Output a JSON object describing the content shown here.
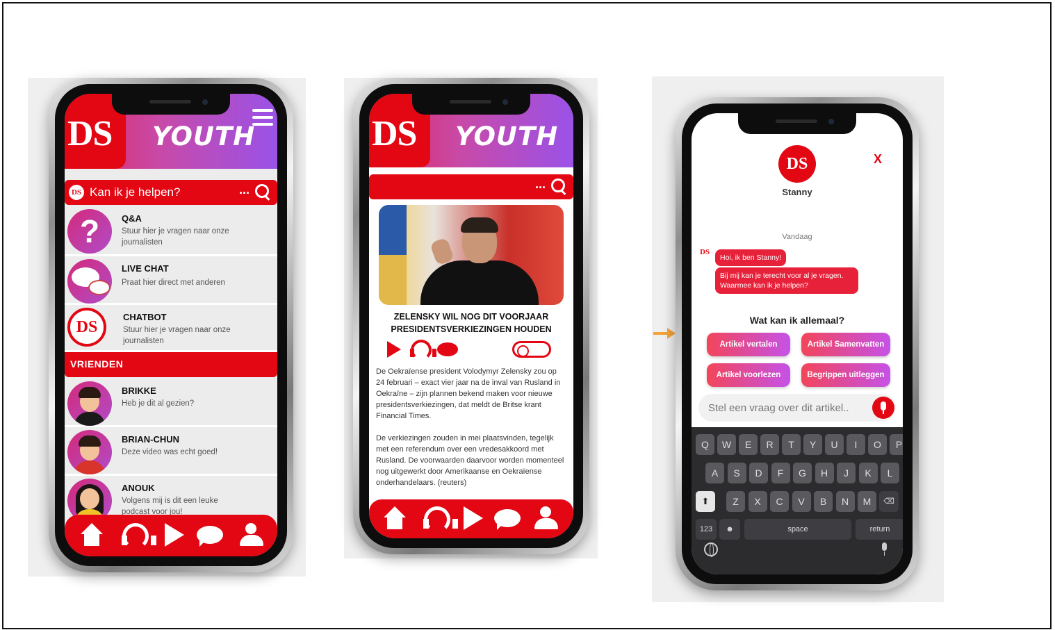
{
  "brand": {
    "ds": "DS",
    "youth": "YOUTH",
    "logo_mini": "DS"
  },
  "phone1": {
    "search": {
      "placeholder": "Kan ik je helpen?",
      "dots": "..."
    },
    "items": [
      {
        "title": "Q&A",
        "subtitle": "Stuur hier je vragen naar onze journalisten",
        "icon": "question-icon",
        "glyph": "?"
      },
      {
        "title": "LIVE CHAT",
        "subtitle": "Praat hier direct met anderen",
        "icon": "chat-bubbles-icon"
      },
      {
        "title": "CHATBOT",
        "subtitle": "Stuur hier je vragen naar onze journalisten",
        "icon": "chatbot-logo-icon",
        "glyph": "DS"
      }
    ],
    "section_label": "VRIENDEN",
    "friends": [
      {
        "name": "BRIKKE",
        "message": "Heb je dit al gezien?"
      },
      {
        "name": "BRIAN-CHUN",
        "message": "Deze video was echt goed!"
      },
      {
        "name": "ANOUK",
        "message": "Volgens mij is dit een leuke podcast voor jou!"
      }
    ]
  },
  "phone2": {
    "search": {
      "dots": "..."
    },
    "headline": "ZELENSKY WIL NOG DIT VOORJAAR PRESIDENTSVERKIEZINGEN HOUDEN",
    "paragraph1": "De Oekraïense president Volodymyr Zelensky zou op 24 februari – exact vier jaar na de inval van Rusland in Oekraïne – zijn plannen bekend maken voor nieuwe presidentsverkiezingen, dat meldt de Britse krant Financial Times.",
    "paragraph2": "De verkiezingen zouden in mei plaatsvinden, tegelijk met een referendum over een vredesakkoord met Rusland. De voorwaarden daarvoor worden momenteel nog uitgewerkt door Amerikaanse en Oekraïense onderhandelaars. (reuters)"
  },
  "phone3": {
    "bot_logo": "DS",
    "bot_name": "Stanny",
    "close": "X",
    "date": "Vandaag",
    "messages": [
      "Hoi, ik ben Stanny!",
      "Bij mij kan je terecht voor al je vragen. Waarmee kan ik je helpen?"
    ],
    "options_title": "Wat kan ik allemaal?",
    "options": [
      "Artikel vertalen",
      "Artikel Samenvatten",
      "Artikel voorlezen",
      "Begrippen uitleggen"
    ],
    "input_placeholder": "Stel een vraag over dit artikel..",
    "keyboard": {
      "row1": [
        "Q",
        "W",
        "E",
        "R",
        "T",
        "Y",
        "U",
        "I",
        "O",
        "P"
      ],
      "row2": [
        "A",
        "S",
        "D",
        "F",
        "G",
        "H",
        "J",
        "K",
        "L"
      ],
      "row3": [
        "Z",
        "X",
        "C",
        "V",
        "B",
        "N",
        "M"
      ],
      "num": "123",
      "emoji": "☻",
      "space": "space",
      "return": "return",
      "shift": "⬆",
      "backspace": "⌫"
    }
  },
  "colors": {
    "brand_red": "#e30613",
    "gradient_pink": "#e0255a",
    "gradient_purple": "#9a52e8",
    "arrow_orange": "#f2a33a"
  }
}
